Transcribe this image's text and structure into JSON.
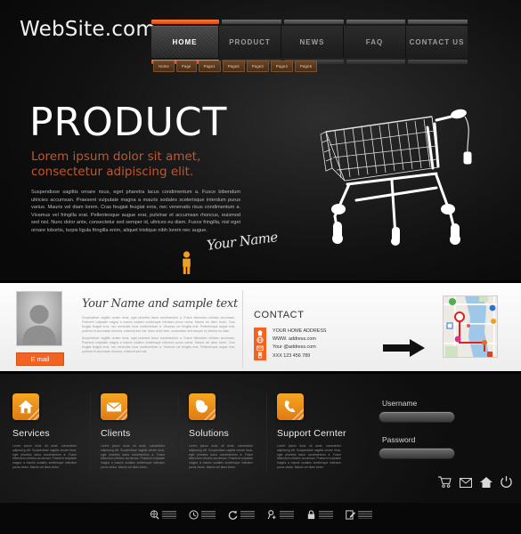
{
  "site": {
    "logo": "WebSite.com"
  },
  "nav": {
    "items": [
      {
        "label": "HOME",
        "active": true
      },
      {
        "label": "PRODUCT",
        "active": false
      },
      {
        "label": "NEWS",
        "active": false
      },
      {
        "label": "FAQ",
        "active": false
      },
      {
        "label": "CONTACT US",
        "active": false
      }
    ],
    "subitems": [
      {
        "label": "Home"
      },
      {
        "label": "Page"
      },
      {
        "label": "Page1"
      },
      {
        "label": "Page2"
      },
      {
        "label": "Page3"
      },
      {
        "label": "Page4"
      },
      {
        "label": "Page5"
      }
    ]
  },
  "hero": {
    "title": "PRODUCT",
    "subtitle": "Lorem ipsum dolor sit amet, consectetur adipiscing elit.",
    "body": "Suspendisse sagittis ornare risus, eget pharetra lacus condimentum a. Fusce bibendum ultricies accumsan. Praesent vulputate magna a mauris sodales scelerisque interdum purus varius. Mauris vel diam lorem. Cras feugiat feugiat eros, nec venenatis risus condimentum a. Vivamus vel fringilla erat. Pellentesque augue erat, pulvinar et accumsan rhoncus, euismod sed nisl. Nunc dolor ante, consectetur sed semper id, ultrices eu diam. Fusce fringilla, nisl eget ornare lobortis, turpis ligula fringilla enim, aliquet tristique nibh lorem nec augue.",
    "signature": "Your Name",
    "illustration": "shopping-cart-wireframe"
  },
  "profile": {
    "avatar_alt": "user-avatar-placeholder",
    "email_button": "E mail",
    "heading": "Your Name and sample text",
    "paragraph1": "Suspendisse sagittis ornare risus, eget pharetra lacus condimentum a. Fusce bibendum ultricies accumsan. Praesent vulputate magna a mauris sodales scelerisque interdum purus varius. Mauris vel diam lorem. Cras feugiat feugiat eros, nec venenatis risus condimentum a. Vivamus vel fringilla erat. Pellentesque augue erat, pulvinar et accumsan rhoncus, euismod sed nisl. Nunc dolor ante, consectetur sed semper id, ultrices eu diam.",
    "paragraph2": "Suspendisse sagittis ornare risus, eget pharetra lacus condimentum a. Fusce bibendum ultricies accumsan. Praesent vulputate magna a mauris sodales scelerisque interdum purus varius. Mauris vel diam lorem. Cras feugiat feugiat eros, nec venenatis risus condimentum a. Vivamus vel fringilla erat. Pellentesque augue erat, pulvinar et accumsan rhoncus, euismod sed nisl."
  },
  "contact": {
    "title": "CONTACT",
    "rows": [
      {
        "icon": "home-icon",
        "text": "YOUR HOME ADDRESS"
      },
      {
        "icon": "globe-icon",
        "text": "WWW. address.com"
      },
      {
        "icon": "envelope-icon",
        "text": "Your @address.com"
      },
      {
        "icon": "mobile-icon",
        "text": "XXX 123 456 789"
      }
    ],
    "arrow": "arrow-right-icon",
    "map": "location-map-thumbnail"
  },
  "services": [
    {
      "icon": "home-icon",
      "title": "Services",
      "body": "Lorem ipsum dolor sit amet, consectetur adipiscing elit. Suspendisse sagittis ornare risus, eget pharetra lacus condimentum a. Fusce bibendum ultricies accumsan. Praesent vulputate magna a mauris sodales scelerisque interdum purus varius. Mauris vel diam lorem."
    },
    {
      "icon": "envelope-icon",
      "title": "Clients",
      "body": "Lorem ipsum dolor sit amet, consectetur adipiscing elit. Suspendisse sagittis ornare risus, eget pharetra lacus condimentum a. Fusce bibendum ultricies accumsan. Praesent vulputate magna a mauris sodales scelerisque interdum purus varius. Mauris vel diam lorem."
    },
    {
      "icon": "globe-icon",
      "title": "Solutions",
      "body": "Lorem ipsum dolor sit amet, consectetur adipiscing elit. Suspendisse sagittis ornare risus, eget pharetra lacus condimentum a. Fusce bibendum ultricies accumsan. Praesent vulputate magna a mauris sodales scelerisque interdum purus varius. Mauris vel diam lorem."
    },
    {
      "icon": "phone-icon",
      "title": "Support Cernter",
      "body": "Lorem ipsum dolor sit amet, consectetur adipiscing elit. Suspendisse sagittis ornare risus, eget pharetra lacus condimentum a. Fusce bibendum ultricies accumsan. Praesent vulputate magna a mauris sodales scelerisque interdum purus varius. Mauris vel diam lorem."
    }
  ],
  "login": {
    "username_label": "Username",
    "username_value": "",
    "password_label": "Password",
    "password_value": ""
  },
  "util_icons": [
    {
      "name": "shopping-cart-icon"
    },
    {
      "name": "envelope-icon"
    },
    {
      "name": "home-icon"
    },
    {
      "name": "power-icon"
    }
  ],
  "footer_icons": [
    {
      "name": "globe-search-icon"
    },
    {
      "name": "clock-icon"
    },
    {
      "name": "refresh-icon"
    },
    {
      "name": "add-user-icon"
    },
    {
      "name": "lock-icon"
    },
    {
      "name": "edit-document-icon"
    }
  ],
  "colors": {
    "accent_orange": "#f26322",
    "icon_orange": "#f5a623",
    "hero_subtitle": "#c1582c",
    "background_dark": "#0c0c0c",
    "mid_band": "#fdfdfd"
  }
}
